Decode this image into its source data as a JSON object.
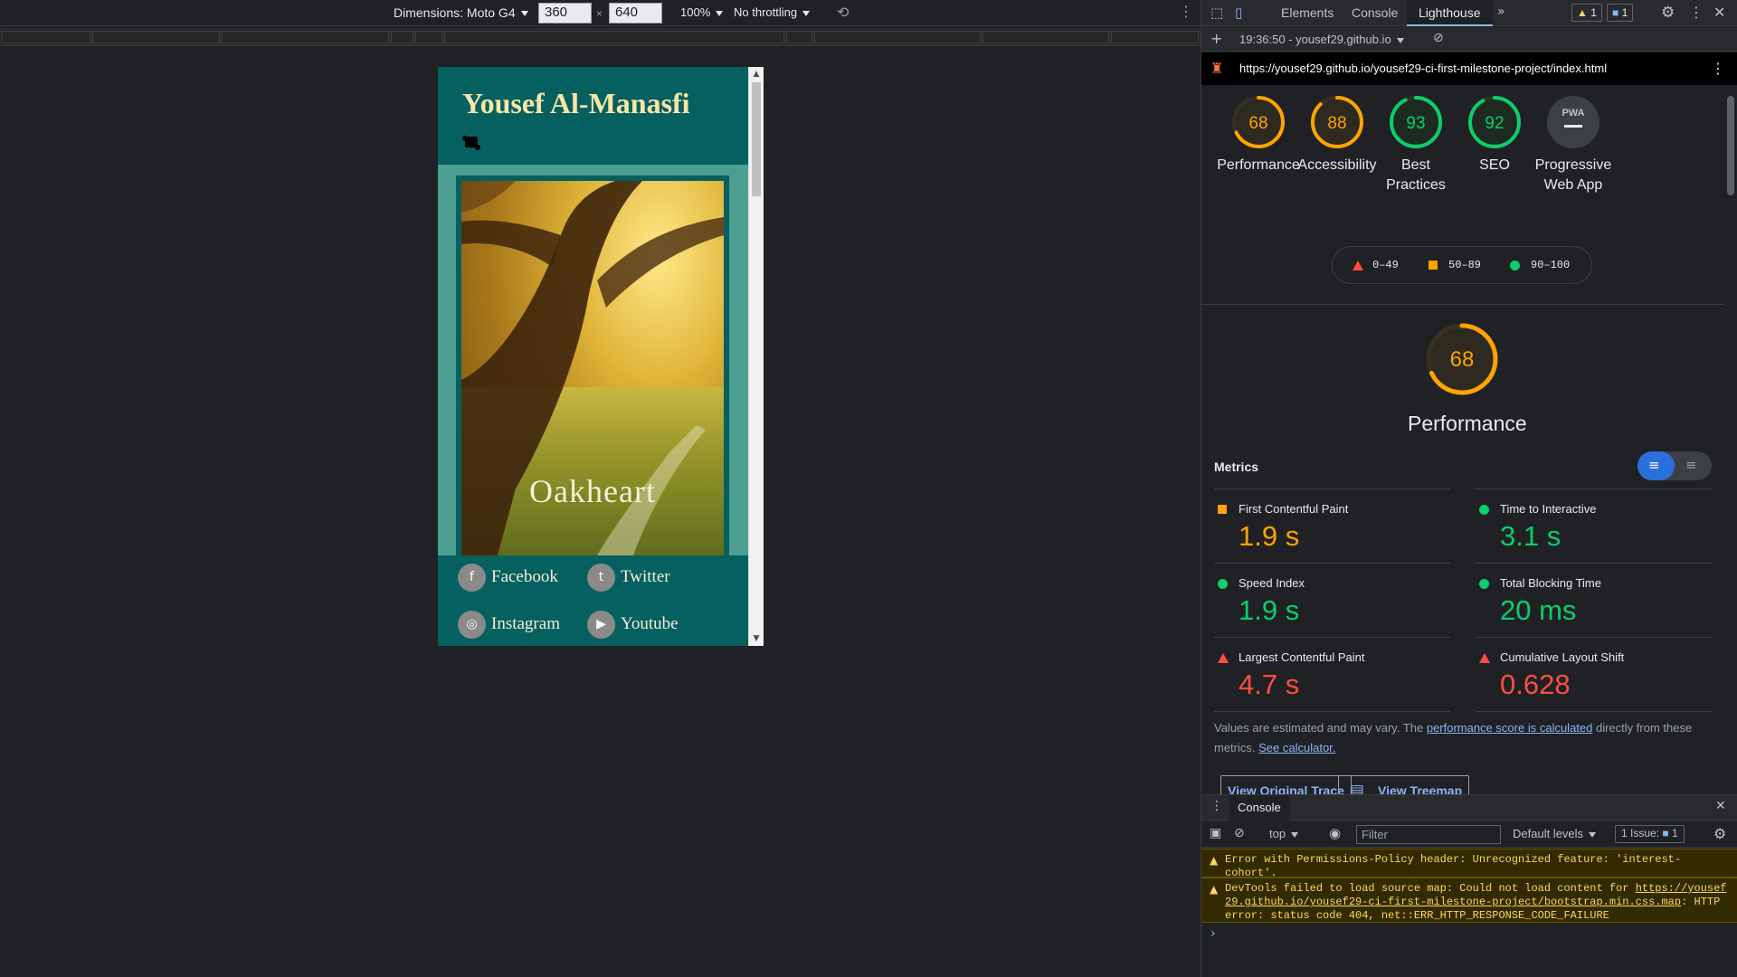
{
  "emulation": {
    "dimensions_label": "Dimensions: Moto G4",
    "width_value": "360",
    "times_sign": "×",
    "height_value": "640",
    "zoom": "100%",
    "throttling": "No throttling"
  },
  "site": {
    "title": "Yousef Al-Manasfi",
    "hero_caption": "Oakheart",
    "social": [
      {
        "label": "Facebook",
        "icon": "f"
      },
      {
        "label": "Twitter",
        "icon": "t"
      },
      {
        "label": "Instagram",
        "icon": "◎"
      },
      {
        "label": "Youtube",
        "icon": "▶"
      }
    ]
  },
  "devtools": {
    "tabs": [
      "Elements",
      "Console",
      "Lighthouse"
    ],
    "active_tab": "Lighthouse",
    "warning_count": "1",
    "message_count": "1",
    "report_time": "19:36:50 - yousef29.github.io",
    "url": "https://yousef29.github.io/yousef29-ci-first-milestone-project/index.html"
  },
  "lighthouse": {
    "scores": [
      {
        "score": "68",
        "label": "Performance",
        "color": "#ffa400",
        "fraction": 0.68
      },
      {
        "score": "88",
        "label": "Accessibility",
        "color": "#ffa400",
        "fraction": 0.88
      },
      {
        "score": "93",
        "label": "Best Practices",
        "color": "#0cce6b",
        "fraction": 0.93
      },
      {
        "score": "92",
        "label": "SEO",
        "color": "#0cce6b",
        "fraction": 0.92
      },
      {
        "score": "PWA",
        "label": "Progressive Web App",
        "color": "#9aa0a6",
        "fraction": 0
      }
    ],
    "legend": [
      "0–49",
      "50–89",
      "90–100"
    ],
    "main_score": "68",
    "main_label": "Performance",
    "main_fraction": 0.68,
    "metrics_heading": "Metrics",
    "metrics": [
      {
        "name": "First Contentful Paint",
        "value": "1.9 s",
        "status": "average",
        "color": "#ffa400"
      },
      {
        "name": "Time to Interactive",
        "value": "3.1 s",
        "status": "pass",
        "color": "#0cce6b"
      },
      {
        "name": "Speed Index",
        "value": "1.9 s",
        "status": "pass",
        "color": "#0cce6b"
      },
      {
        "name": "Total Blocking Time",
        "value": "20 ms",
        "status": "pass",
        "color": "#0cce6b"
      },
      {
        "name": "Largest Contentful Paint",
        "value": "4.7 s",
        "status": "fail",
        "color": "#ff4e42"
      },
      {
        "name": "Cumulative Layout Shift",
        "value": "0.628",
        "status": "fail",
        "color": "#ff4e42"
      }
    ],
    "note_prefix": "Values are estimated and may vary. The ",
    "note_link": "performance score is calculated",
    "note_middle": " directly from these metrics. ",
    "note_link2": "See calculator.",
    "btn_trace": "View Original Trace",
    "btn_treemap": "View Treemap"
  },
  "console": {
    "tab": "Console",
    "context": "top",
    "filter_placeholder": "Filter",
    "levels": "Default levels",
    "issues": "1 Issue:",
    "issues_count": "1",
    "messages": [
      {
        "text": "Error with Permissions-Policy header: Unrecognized feature: 'interest-cohort'."
      },
      {
        "prefix": "DevTools failed to load source map: Could not load content for ",
        "link": "https://yousef29.github.io/yousef29-ci-first-milestone-project/bootstrap.min.css.map",
        "suffix": ": HTTP error: status code 404, net::ERR_HTTP_RESPONSE_CODE_FAILURE"
      }
    ],
    "prompt": "›"
  }
}
